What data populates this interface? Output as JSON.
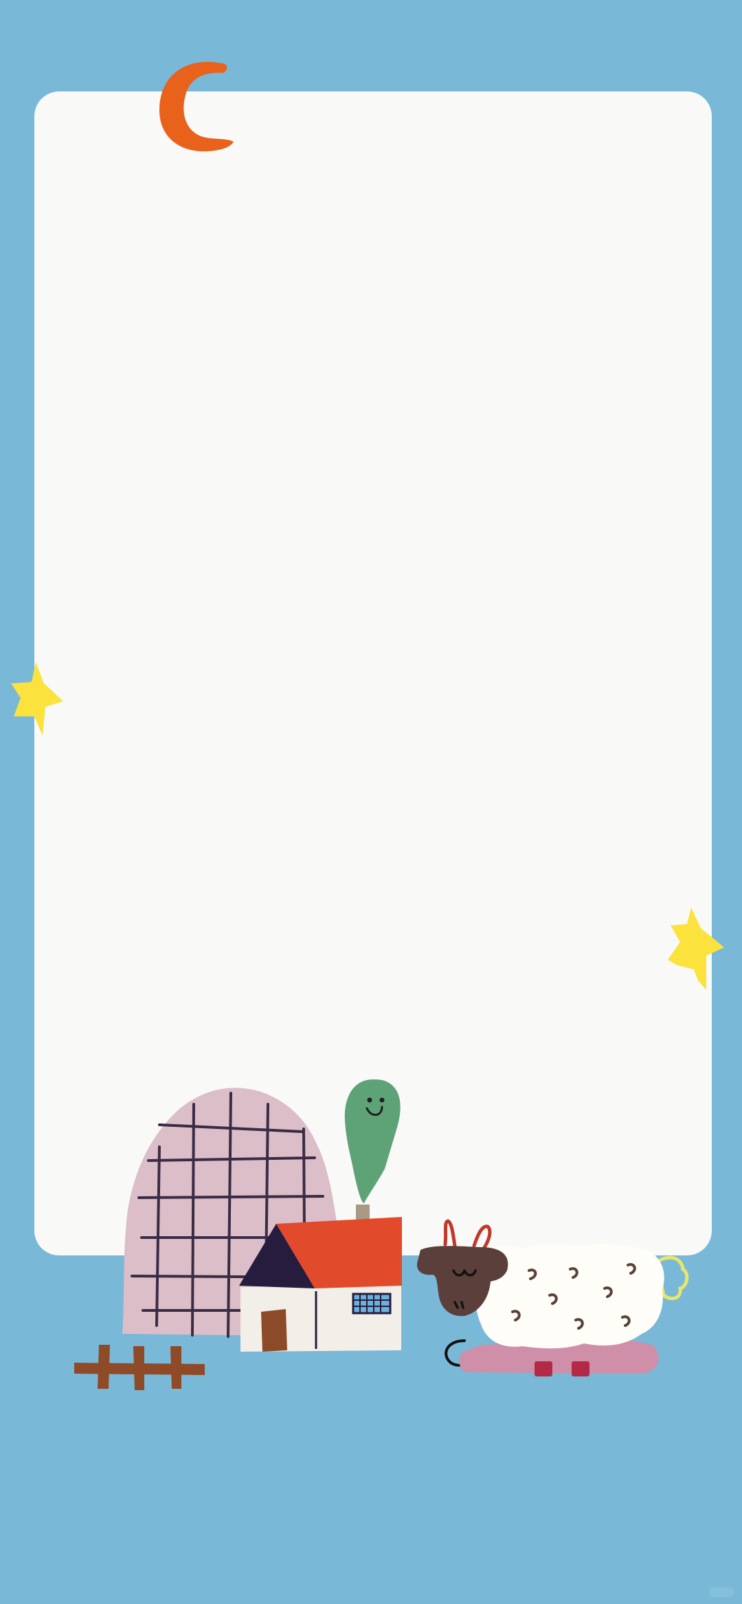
{
  "colors": {
    "background": "#79b9d7",
    "card": "#f9f9f8",
    "moon": "#e8621b",
    "star": "#fbe23c",
    "igloo": "#dbbec8",
    "grid_lines": "#3a2c45",
    "roof_red": "#e14a2b",
    "roof_dark": "#261c3e",
    "house_wall": "#f2efe8",
    "door": "#8c4a28",
    "window": "#6ab2dc",
    "chimney": "#a89a84",
    "tree": "#5da377",
    "fence": "#8f4a28",
    "sheep_body": "#fffdf7",
    "sheep_head": "#5b3f3a",
    "sheep_ears": "#c0392b",
    "sheep_legs": "#cf8fa8",
    "sheep_hooves": "#b32a48",
    "sheep_tail": "#e9e56a"
  },
  "icons": {
    "moon": "crescent-moon",
    "star_left": "star",
    "star_right": "star",
    "igloo": "checkered-igloo",
    "house": "house",
    "tree": "smiling-tree",
    "fence": "wooden-fence",
    "sheep": "lying-sheep"
  }
}
